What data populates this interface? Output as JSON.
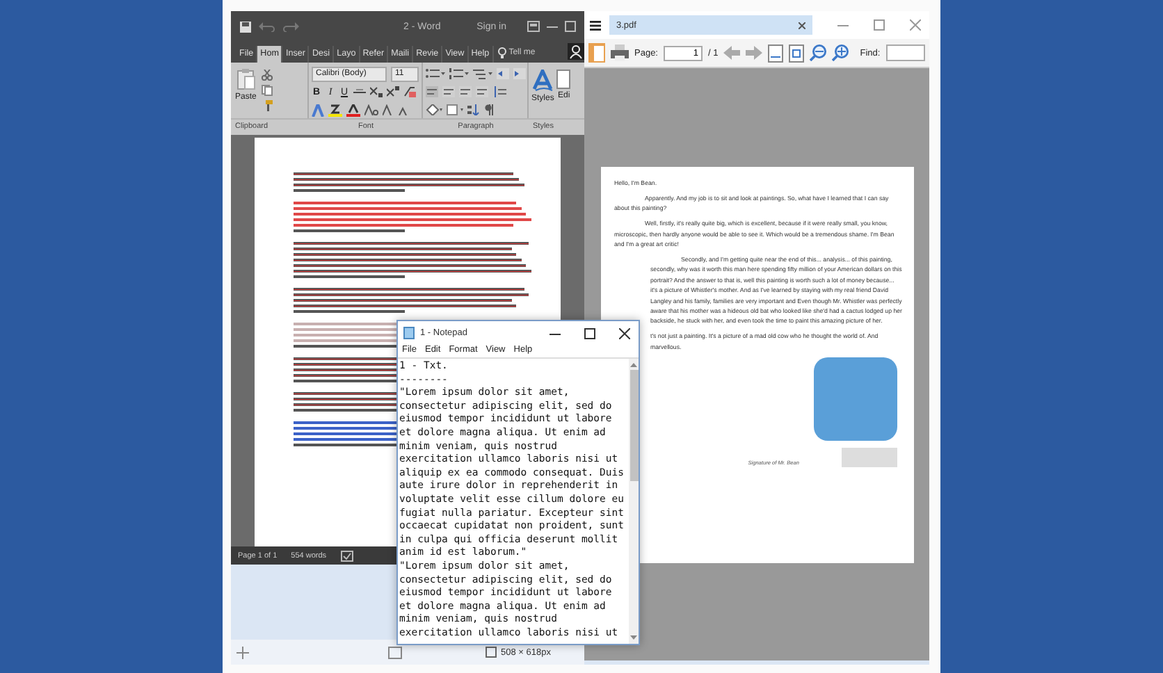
{
  "word": {
    "title": "2 - Word",
    "sign_in": "Sign in",
    "tell_me": "Tell me",
    "tabs": [
      {
        "label": "File",
        "selected": false
      },
      {
        "label": "Hom",
        "selected": true
      },
      {
        "label": "Inser",
        "selected": false
      },
      {
        "label": "Desi",
        "selected": false
      },
      {
        "label": "Layo",
        "selected": false
      },
      {
        "label": "Refer",
        "selected": false
      },
      {
        "label": "Maili",
        "selected": false
      },
      {
        "label": "Revie",
        "selected": false
      },
      {
        "label": "View",
        "selected": false
      },
      {
        "label": "Help",
        "selected": false
      }
    ],
    "ribbon": {
      "paste": "Paste",
      "font": "Calibri (Body)",
      "size": "11",
      "format_buttons": [
        "B",
        "I",
        "U"
      ],
      "styles": "Styles",
      "editing": "Edi",
      "groups": [
        "Clipboard",
        "Font",
        "Paragraph",
        "Styles"
      ]
    },
    "status_bar": {
      "page": "Page 1 of 1",
      "words": "554 words"
    }
  },
  "pdf": {
    "tab": "3.pdf",
    "page_label": "Page:",
    "page": "1",
    "page_total": "/ 1",
    "find_label": "Find:",
    "paragraphs": [
      {
        "kind": "plain",
        "text": "Hello, I'm Bean."
      },
      {
        "kind": "indent",
        "text": "Apparently. And my job is to sit and look at paintings. So, what have I learned that I can say about this painting?"
      },
      {
        "kind": "indent",
        "text": "Well, firstly, it's really quite big, which is excellent, because if it were really small, you know, microscopic, then hardly anyone would be able to see it. Which would be a tremendous shame. I'm Bean and I'm a great art critic!"
      },
      {
        "kind": "indent",
        "text": "Secondly, and I'm getting quite near the end of this... analysis... of this painting, secondly, why was it worth this man here spending fifty million of your American dollars on this portrait? And the answer to that is, well this painting is worth such a lot of money because... it's a picture of Whistler's mother. And as I've learned by staying with my real friend David Langley and his family, families are very important and Even though Mr. Whistler was perfectly aware that his mother was a hideous old bat who looked like she'd had a cactus lodged up her backside, he stuck with her, and even took the time to paint this amazing picture of her."
      },
      {
        "kind": "covered",
        "text": "t's not just a painting. It's a picture of a mad old cow who he thought the world of. And marvellous."
      }
    ],
    "caption": "Signature of Mr. Bean"
  },
  "notepad": {
    "title": "1 - Notepad",
    "menu": [
      "File",
      "Edit",
      "Format",
      "View",
      "Help"
    ],
    "lines": [
      "1 - Txt.",
      "--------",
      "\"Lorem ipsum dolor sit amet,",
      "consectetur adipiscing elit, sed do",
      "eiusmod tempor incididunt ut labore",
      "et dolore magna aliqua. Ut enim ad",
      "minim veniam, quis nostrud",
      "exercitation ullamco laboris nisi ut",
      "aliquip ex ea commodo consequat. Duis",
      "aute irure dolor in reprehenderit in",
      "voluptate velit esse cillum dolore eu",
      "fugiat nulla pariatur. Excepteur sint",
      "occaecat cupidatat non proident, sunt",
      "in culpa qui officia deserunt mollit",
      "anim id est laborum.\"",
      "\"Lorem ipsum dolor sit amet,",
      "consectetur adipiscing elit, sed do",
      "eiusmod tempor incididunt ut labore",
      "et dolore magna aliqua. Ut enim ad",
      "minim veniam, quis nostrud",
      "exercitation ullamco laboris nisi ut"
    ]
  },
  "editor_status": {
    "size": "508 × 618px"
  }
}
